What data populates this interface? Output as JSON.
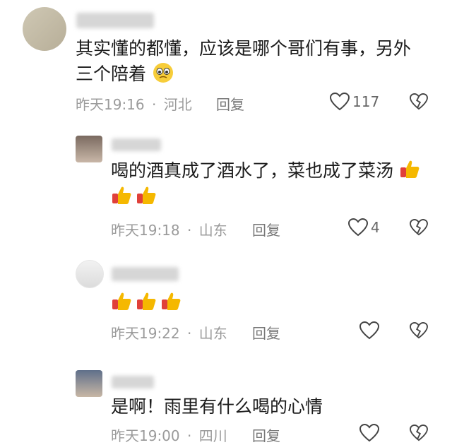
{
  "comments": [
    {
      "text_line1": "其实懂的都懂，应该是哪个哥们有事，另外",
      "text_line2": "三个陪着",
      "emoji": "pleading-face",
      "time": "昨天19:16",
      "location": "河北",
      "reply_label": "回复",
      "likes": "117"
    },
    {
      "text_line1": "喝的酒真成了酒水了，菜也成了菜汤",
      "emoji": "thumbs-up",
      "time": "昨天19:18",
      "location": "山东",
      "reply_label": "回复",
      "likes": "4"
    },
    {
      "emoji": "thumbs-up",
      "time": "昨天19:22",
      "location": "山东",
      "reply_label": "回复",
      "likes": ""
    },
    {
      "text_line1": "是啊！雨里有什么喝的心情",
      "time": "昨天19:00",
      "location": "四川",
      "reply_label": "回复"
    }
  ],
  "separator": "·",
  "colors": {
    "meta_gray": "#9b9b9b",
    "thumb_yellow": "#f5b800",
    "thumb_red": "#e0403a"
  }
}
